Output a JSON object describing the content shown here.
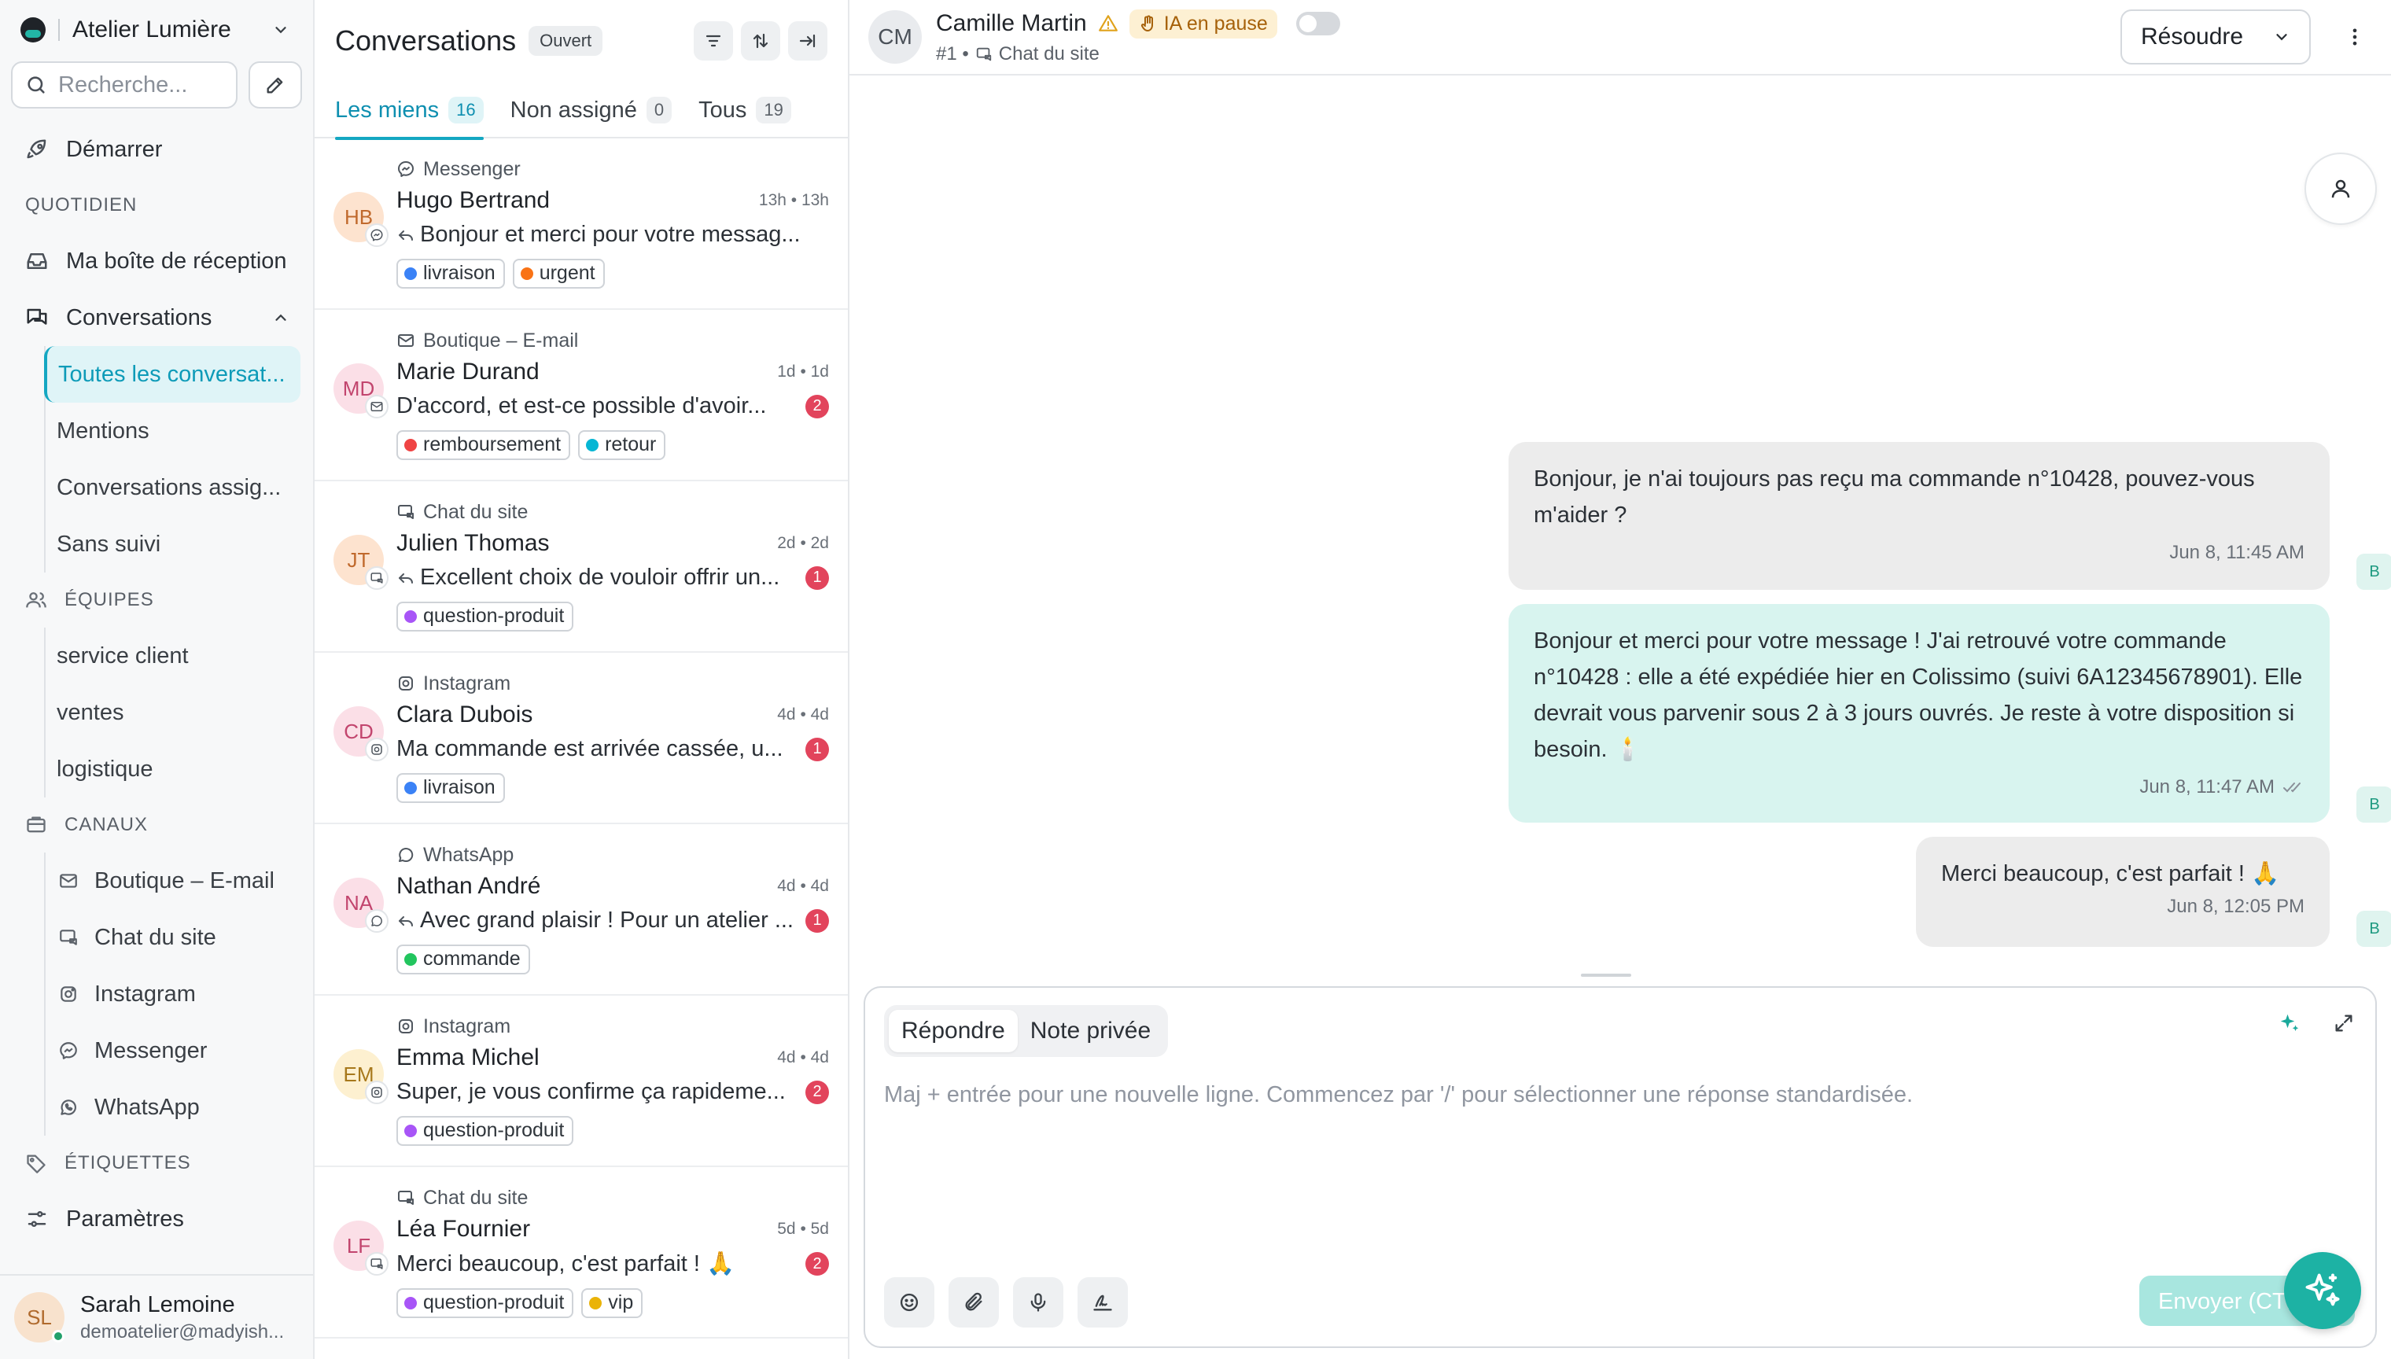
{
  "workspace": {
    "name": "Atelier Lumière"
  },
  "search": {
    "placeholder": "Recherche..."
  },
  "sidebar": {
    "start": "Démarrer",
    "section_daily": "QUOTIDIEN",
    "inbox": "Ma boîte de réception",
    "conversations": "Conversations",
    "conversation_items": [
      "Toutes les conversat...",
      "Mentions",
      "Conversations assig...",
      "Sans suivi"
    ],
    "section_teams": "ÉQUIPES",
    "teams": [
      "service client",
      "ventes",
      "logistique"
    ],
    "section_channels": "CANAUX",
    "channels": [
      "Boutique – E-mail",
      "Chat du site",
      "Instagram",
      "Messenger",
      "WhatsApp"
    ],
    "section_labels": "ÉTIQUETTES",
    "settings": "Paramètres"
  },
  "user": {
    "initials": "SL",
    "name": "Sarah Lemoine",
    "email": "demoatelier@madyish..."
  },
  "list": {
    "title": "Conversations",
    "status": "Ouvert",
    "tabs": [
      {
        "label": "Les miens",
        "count": "16"
      },
      {
        "label": "Non assigné",
        "count": "0"
      },
      {
        "label": "Tous",
        "count": "19"
      }
    ],
    "conversations": [
      {
        "initials": "HB",
        "channel": "Messenger",
        "name": "Hugo Bertrand",
        "time": "13h • 13h",
        "message": "Bonjour et merci pour votre messag...",
        "reply": true,
        "unread": "",
        "labels": [
          {
            "name": "livraison",
            "color": "#3b82f6"
          },
          {
            "name": "urgent",
            "color": "#f97316"
          }
        ]
      },
      {
        "initials": "MD",
        "channel": "Boutique – E-mail",
        "name": "Marie Durand",
        "time": "1d • 1d",
        "message": "D'accord, et est-ce possible d'avoir...",
        "reply": false,
        "unread": "2",
        "labels": [
          {
            "name": "remboursement",
            "color": "#ef4444"
          },
          {
            "name": "retour",
            "color": "#06b6d4"
          }
        ]
      },
      {
        "initials": "JT",
        "channel": "Chat du site",
        "name": "Julien Thomas",
        "time": "2d • 2d",
        "message": "Excellent choix de vouloir offrir un...",
        "reply": true,
        "unread": "1",
        "labels": [
          {
            "name": "question-produit",
            "color": "#a855f7"
          }
        ]
      },
      {
        "initials": "CD",
        "channel": "Instagram",
        "name": "Clara Dubois",
        "time": "4d • 4d",
        "message": "Ma commande est arrivée cassée, u...",
        "reply": false,
        "unread": "1",
        "labels": [
          {
            "name": "livraison",
            "color": "#3b82f6"
          }
        ]
      },
      {
        "initials": "NA",
        "channel": "WhatsApp",
        "name": "Nathan André",
        "time": "4d • 4d",
        "message": "Avec grand plaisir ! Pour un atelier ...",
        "reply": true,
        "unread": "1",
        "labels": [
          {
            "name": "commande",
            "color": "#22c55e"
          }
        ]
      },
      {
        "initials": "EM",
        "channel": "Instagram",
        "name": "Emma Michel",
        "time": "4d • 4d",
        "message": "Super, je vous confirme ça rapideme...",
        "reply": false,
        "unread": "2",
        "labels": [
          {
            "name": "question-produit",
            "color": "#a855f7"
          }
        ]
      },
      {
        "initials": "LF",
        "channel": "Chat du site",
        "name": "Léa Fournier",
        "time": "5d • 5d",
        "message": "Merci beaucoup, c'est parfait ! 🙏",
        "reply": false,
        "unread": "2",
        "labels": [
          {
            "name": "question-produit",
            "color": "#a855f7"
          },
          {
            "name": "vip",
            "color": "#eab308"
          }
        ]
      }
    ]
  },
  "chat": {
    "contact_initials": "CM",
    "contact_name": "Camille Martin",
    "ai_status": "IA en pause",
    "conversation_id": "#1 •",
    "channel": "Chat du site",
    "resolve_label": "Résoudre",
    "messages": [
      {
        "direction": "in",
        "text": "Bonjour, je n'ai toujours pas reçu ma commande n°10428, pouvez-vous m'aider ?",
        "time": "Jun 8, 11:45 AM",
        "sender": "B"
      },
      {
        "direction": "out",
        "text": "Bonjour et merci pour votre message ! J'ai retrouvé votre commande n°10428 : elle a été expédiée hier en Colissimo (suivi 6A12345678901). Elle devrait vous parvenir sous 2 à 3 jours ouvrés. Je reste à votre disposition si besoin. 🕯️",
        "time": "Jun 8, 11:47 AM",
        "sender": "B"
      },
      {
        "direction": "in",
        "text": "Merci beaucoup, c'est parfait ! 🙏",
        "time": "Jun 8, 12:05 PM",
        "sender": "B"
      }
    ],
    "composer": {
      "tab_reply": "Répondre",
      "tab_note": "Note privée",
      "placeholder": "Maj + entrée pour une nouvelle ligne. Commencez par '/' pour sélectionner une réponse standardisée.",
      "send_label": "Envoyer (CTRL + ↵)"
    }
  }
}
